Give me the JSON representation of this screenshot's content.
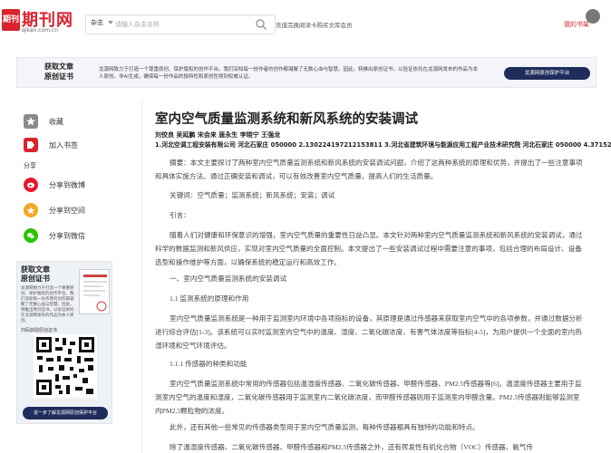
{
  "header": {
    "logo_badge": "期刊",
    "logo_name": "期刊网",
    "logo_domain": "qikan.com.cn",
    "search_category": "杂志",
    "search_placeholder": "请输入杂志名称",
    "top_links": "充值完换阅读卡购买文库会员",
    "my_books": "我的书架"
  },
  "banner": {
    "title_line1": "获取文章",
    "title_line2": "原创证书",
    "text": "龙源网致力于打造一个尊重原创、保护版权的创作平台。我们深知每一份作者的创作都凝聚了无数心血与智慧。因此，特推出原创证书，以验证依托在龙源网发布的作品为本人原创。非AI生成，确保每一份作品的独特性和原创性得到权威认证。",
    "button": "龙源网原创保护平台"
  },
  "sidebar": {
    "collect": "收藏",
    "tag": "加入书签",
    "share_title": "分享",
    "weibo": "分享到微博",
    "qzone": "分享到空间",
    "wechat": "分享到微信"
  },
  "ad": {
    "title_line1": "获取文章",
    "title_line2": "原创证书",
    "text": "龙源网致力于打造一个尊重原创、保护版权的创作平台。我们深知每一份作者的创作都凝聚了无数心血与智慧。因此，特推出原创证书，以验证依托在龙源网发布的作品为本人原创。",
    "caption": "扫码获取原创证书",
    "button": "进一步了解龙源网原创保护平台"
  },
  "article": {
    "title": "室内空气质量监测系统和新风系统的安装调试",
    "authors": "刘佼良 吴延鹏 宋会来 唐永生 李晓宁 王强龙",
    "affiliation": "1.河北空调工程安装有限公司 河北石家庄 050000 2.130224197212153811 3.河北省建筑环境与能源应用工程产业技术研究院 河北石家庄 050000 4.37152",
    "paragraphs": [
      "摘要：本文主要探讨了两种室内空气质量监测系统和新风系统的安装调试问题，介绍了这两种系统的原理和优势，并提出了一些注意事项和具体实施方法。通过正确安装和调试，可以有效改善室内空气质量，提高人们的生活质量。",
      "关键词：空气质量；监测系统；新风系统；安装；调试",
      "引言：",
      "随着人们对健康和环保意识的增强，室内空气质量的重要性日益凸显。本文针对两种室内空气质量监测系统和新风系统的安装调试，通过科学的数据监测和新风供应，实现对室内空气质量的全面控制。本文提出了一些安装调试过程中需要注意的事项，包括合理的布局设计、设备选型和操作维护等方面，以确保系统的稳定运行和高效工作。",
      "一、室内空气质量监测系统的安装调试",
      "1.1 监测系统的原理和作用",
      "室内空气质量监测系统是一种用于监测室内环境中各项指标的设备，其原理是通过传感器来获取室内空气中的各项参数，并通过数据分析进行综合评估[1-3]。该系统可以实时监测室内空气中的温度、湿度、二氧化碳浓度、有害气体浓度等指标[4-5]，为用户提供一个全面的室内热湿环境和空气环境评估。",
      "1.1.1 传感器的种类和功能",
      "室内空气质量监测系统中常用的传感器包括温湿度传感器、二氧化碳传感器、甲醛传感器、PM2.5传感器等[6]。温湿度传感器主要用于监测室内空气的温度和湿度，二氧化碳传感器用于监测室内二氧化碳浓度，而甲醛传感器则用于监测室内甲醛含量。PM2.5传感器则能够监测室内PM2.5颗粒物的浓度。",
      "此外，还有其他一些常见的传感器类型用于室内空气质量监测，每种传感器都具有独特的功能和特点。",
      "除了温湿度传感器、二氧化碳传感器、甲醛传感器和PM2.5传感器之外，还有挥发性有机化合物（VOC）传感器、氨气传"
    ]
  },
  "colors": {
    "brand_red": "#d9232d",
    "navy": "#1f2d5c"
  }
}
